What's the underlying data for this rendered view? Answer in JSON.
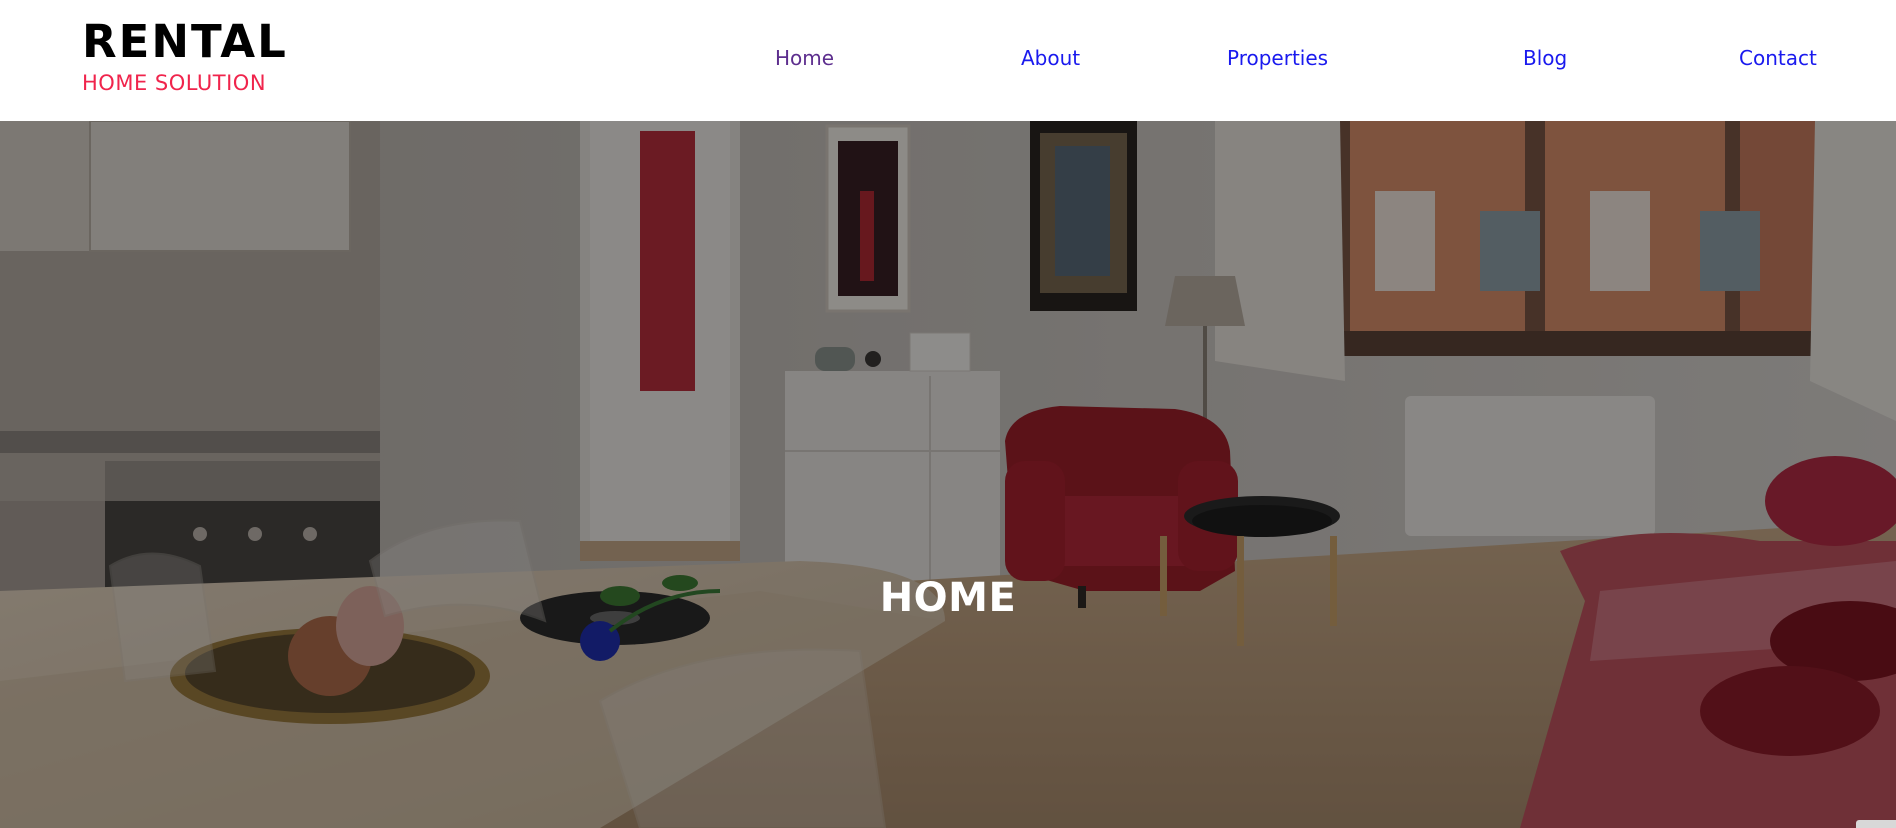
{
  "brand": {
    "title": "RENTAL",
    "subtitle": "HOME SOLUTION",
    "subtitle_color": "#f0244c"
  },
  "nav": {
    "items": [
      {
        "label": "Home",
        "state": "visited"
      },
      {
        "label": "About"
      },
      {
        "label": "Properties"
      },
      {
        "label": "Blog"
      },
      {
        "label": "Contact"
      }
    ],
    "link_color": "#1a1aee",
    "visited_color": "#5d2e8e"
  },
  "hero": {
    "title": "HOME",
    "image": "apartment-living-room-photo"
  }
}
